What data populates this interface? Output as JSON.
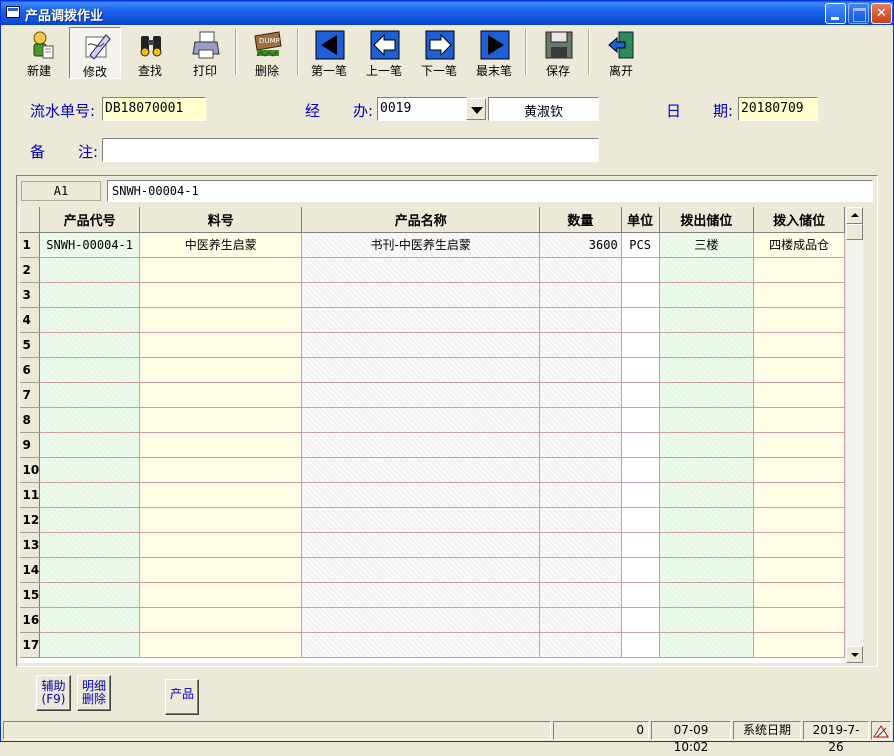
{
  "window": {
    "title": "产品调拨作业"
  },
  "toolbar": {
    "new": "新建",
    "edit": "修改",
    "find": "查找",
    "print": "打印",
    "delete": "删除",
    "first": "第一笔",
    "prev": "上一笔",
    "next": "下一笔",
    "last": "最末笔",
    "save": "保存",
    "exit": "离开",
    "delete_icon_text": "DUMP"
  },
  "form": {
    "serial_label": "流水单号:",
    "serial_value": "DB18070001",
    "handler_label_a": "经",
    "handler_label_b": "办:",
    "handler_code": "0019",
    "handler_name": "黄淑钦",
    "date_label_a": "日",
    "date_label_b": "期:",
    "date_value": "20180709",
    "remark_label_a": "备",
    "remark_label_b": "注:",
    "remark_value": ""
  },
  "grid": {
    "cell_ref": "A1",
    "cell_value": "SNWH-00004-1",
    "columns": [
      "产品代号",
      "料号",
      "产品名称",
      "数量",
      "单位",
      "拨出储位",
      "拨入储位"
    ],
    "rows": [
      {
        "n": "1",
        "code": "SNWH-00004-1",
        "part": "中医养生启蒙",
        "name": "书刊-中医养生启蒙",
        "qty": "3600",
        "unit": "PCS",
        "out": "三楼",
        "in": "四楼成品仓"
      },
      {
        "n": "2",
        "code": "",
        "part": "",
        "name": "",
        "qty": "",
        "unit": "",
        "out": "",
        "in": ""
      },
      {
        "n": "3",
        "code": "",
        "part": "",
        "name": "",
        "qty": "",
        "unit": "",
        "out": "",
        "in": ""
      },
      {
        "n": "4",
        "code": "",
        "part": "",
        "name": "",
        "qty": "",
        "unit": "",
        "out": "",
        "in": ""
      },
      {
        "n": "5",
        "code": "",
        "part": "",
        "name": "",
        "qty": "",
        "unit": "",
        "out": "",
        "in": ""
      },
      {
        "n": "6",
        "code": "",
        "part": "",
        "name": "",
        "qty": "",
        "unit": "",
        "out": "",
        "in": ""
      },
      {
        "n": "7",
        "code": "",
        "part": "",
        "name": "",
        "qty": "",
        "unit": "",
        "out": "",
        "in": ""
      },
      {
        "n": "8",
        "code": "",
        "part": "",
        "name": "",
        "qty": "",
        "unit": "",
        "out": "",
        "in": ""
      },
      {
        "n": "9",
        "code": "",
        "part": "",
        "name": "",
        "qty": "",
        "unit": "",
        "out": "",
        "in": ""
      },
      {
        "n": "10",
        "code": "",
        "part": "",
        "name": "",
        "qty": "",
        "unit": "",
        "out": "",
        "in": ""
      },
      {
        "n": "11",
        "code": "",
        "part": "",
        "name": "",
        "qty": "",
        "unit": "",
        "out": "",
        "in": ""
      },
      {
        "n": "12",
        "code": "",
        "part": "",
        "name": "",
        "qty": "",
        "unit": "",
        "out": "",
        "in": ""
      },
      {
        "n": "13",
        "code": "",
        "part": "",
        "name": "",
        "qty": "",
        "unit": "",
        "out": "",
        "in": ""
      },
      {
        "n": "14",
        "code": "",
        "part": "",
        "name": "",
        "qty": "",
        "unit": "",
        "out": "",
        "in": ""
      },
      {
        "n": "15",
        "code": "",
        "part": "",
        "name": "",
        "qty": "",
        "unit": "",
        "out": "",
        "in": ""
      },
      {
        "n": "16",
        "code": "",
        "part": "",
        "name": "",
        "qty": "",
        "unit": "",
        "out": "",
        "in": ""
      },
      {
        "n": "17",
        "code": "",
        "part": "",
        "name": "",
        "qty": "",
        "unit": "",
        "out": "",
        "in": ""
      }
    ]
  },
  "bottom": {
    "aux_line1": "辅助",
    "aux_line2": "(F9)",
    "detail_line1": "明细",
    "detail_line2": "删除",
    "product": "产品"
  },
  "status": {
    "count": "0",
    "datetime": "07-09 10:02",
    "sysdate_label": "系统日期",
    "sysdate": "2019-7-26"
  },
  "colors": {
    "titlebar": "#1c63ea",
    "label_blue": "#0000c0",
    "field_yellow": "#ffffcc",
    "nav_blue": "#1c5fd6"
  }
}
